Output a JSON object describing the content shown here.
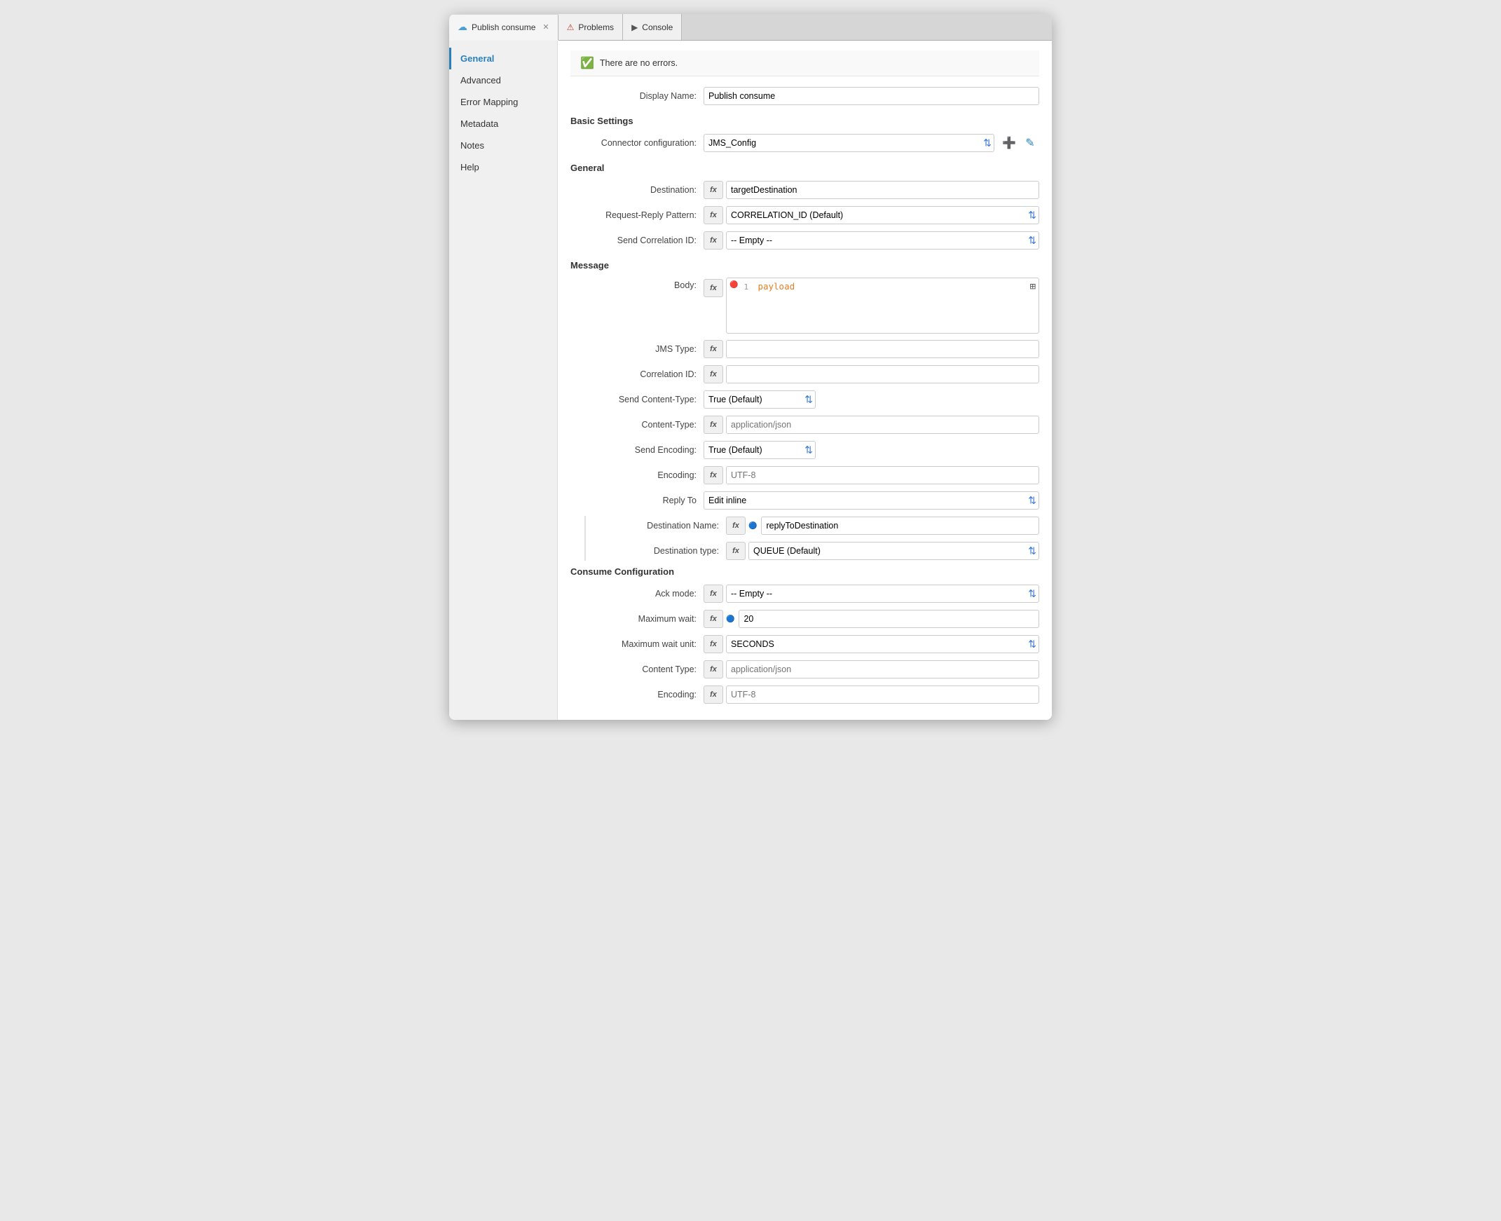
{
  "window": {
    "tabs": [
      {
        "id": "publish-consume",
        "label": "Publish consume",
        "active": true,
        "icon": "cloud-icon",
        "closable": true
      },
      {
        "id": "problems",
        "label": "Problems",
        "active": false,
        "icon": "problems-icon",
        "closable": false
      },
      {
        "id": "console",
        "label": "Console",
        "active": false,
        "icon": "console-icon",
        "closable": false
      }
    ]
  },
  "sidebar": {
    "items": [
      {
        "id": "general",
        "label": "General",
        "active": true
      },
      {
        "id": "advanced",
        "label": "Advanced",
        "active": false
      },
      {
        "id": "error-mapping",
        "label": "Error Mapping",
        "active": false
      },
      {
        "id": "metadata",
        "label": "Metadata",
        "active": false
      },
      {
        "id": "notes",
        "label": "Notes",
        "active": false
      },
      {
        "id": "help",
        "label": "Help",
        "active": false
      }
    ]
  },
  "status": {
    "message": "There are no errors."
  },
  "form": {
    "display_name_label": "Display Name:",
    "display_name_value": "Publish consume",
    "basic_settings_title": "Basic Settings",
    "connector_config_label": "Connector configuration:",
    "connector_config_value": "JMS_Config",
    "general_section_title": "General",
    "destination_label": "Destination:",
    "destination_value": "targetDestination",
    "request_reply_label": "Request-Reply Pattern:",
    "request_reply_value": "CORRELATION_ID (Default)",
    "send_correlation_label": "Send Correlation ID:",
    "send_correlation_value": "-- Empty --",
    "message_section_title": "Message",
    "body_label": "Body:",
    "body_line_num": "1",
    "body_value": "payload",
    "jms_type_label": "JMS Type:",
    "jms_type_value": "",
    "correlation_id_label": "Correlation ID:",
    "correlation_id_value": "",
    "send_content_type_label": "Send Content-Type:",
    "send_content_type_value": "True (Default)",
    "content_type_label": "Content-Type:",
    "content_type_placeholder": "application/json",
    "send_encoding_label": "Send Encoding:",
    "send_encoding_value": "True (Default)",
    "encoding_label": "Encoding:",
    "encoding_placeholder": "UTF-8",
    "reply_to_label": "Reply To",
    "reply_to_value": "Edit inline",
    "destination_name_label": "Destination Name:",
    "destination_name_value": "replyToDestination",
    "destination_type_label": "Destination type:",
    "destination_type_value": "QUEUE (Default)",
    "consume_config_title": "Consume Configuration",
    "ack_mode_label": "Ack mode:",
    "ack_mode_value": "-- Empty --",
    "max_wait_label": "Maximum wait:",
    "max_wait_value": "20",
    "max_wait_unit_label": "Maximum wait unit:",
    "max_wait_unit_value": "SECONDS",
    "content_type2_label": "Content Type:",
    "content_type2_placeholder": "application/json",
    "encoding2_label": "Encoding:",
    "encoding2_placeholder": "UTF-8",
    "fx_label": "fx",
    "add_icon": "➕",
    "edit_icon": "✎"
  }
}
